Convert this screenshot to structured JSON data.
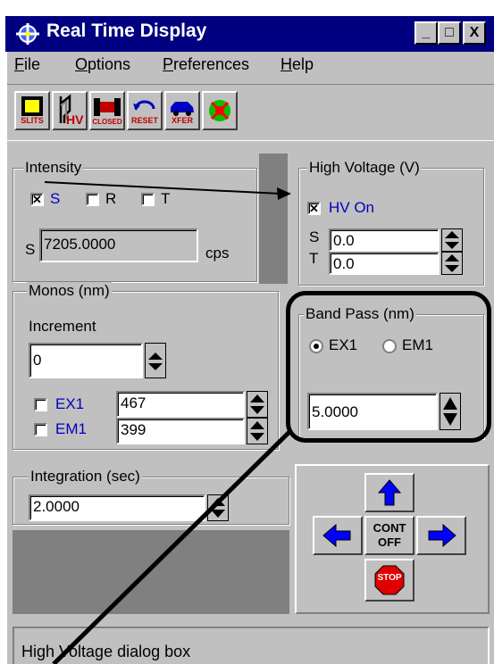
{
  "window": {
    "title": "Real Time Display"
  },
  "title_buttons": {
    "minimize": "_",
    "maximize": "□",
    "close": "X"
  },
  "menu": {
    "file": {
      "label": "File",
      "accel": "F",
      "rest": "ile"
    },
    "options": {
      "label": "Options",
      "accel": "O",
      "rest": "ptions"
    },
    "preferences": {
      "label": "Preferences",
      "accel": "P",
      "rest": "references"
    },
    "help": {
      "label": "Help",
      "accel": "H",
      "rest": "elp"
    }
  },
  "toolbar": {
    "slits": "SLITS",
    "hv": "HV",
    "closed": "CLOSED",
    "reset": "RESET",
    "xfer": "XFER"
  },
  "intensity": {
    "title": "Intensity",
    "checks": [
      {
        "label": "S",
        "checked": true
      },
      {
        "label": "R",
        "checked": false
      },
      {
        "label": "T",
        "checked": false
      }
    ],
    "channel": "S",
    "value": "7205.0000",
    "unit": "cps"
  },
  "high_voltage": {
    "title": "High Voltage (V)",
    "hv_on_label": "HV On",
    "hv_on_checked": true,
    "s_label": "S",
    "s_value": "0.0",
    "t_label": "T",
    "t_value": "0.0"
  },
  "monos": {
    "title": "Monos (nm)",
    "increment_label": "Increment",
    "increment_value": "0",
    "ex1_label": "EX1",
    "ex1_value": "467",
    "em1_label": "EM1",
    "em1_value": "399"
  },
  "band_pass": {
    "title": "Band Pass (nm)",
    "ex1_label": "EX1",
    "em1_label": "EM1",
    "selected": "EX1",
    "value": "5.0000"
  },
  "integration": {
    "title": "Integration (sec)",
    "value": "2.0000"
  },
  "nav": {
    "cont_line1": "CONT",
    "cont_line2": "OFF",
    "stop": "STOP"
  },
  "status": {
    "text": "High Voltage dialog box"
  },
  "colors": {
    "titlebar": "#000080",
    "face": "#c0c0c0",
    "callout": "#000000",
    "link": "#0000c0"
  }
}
